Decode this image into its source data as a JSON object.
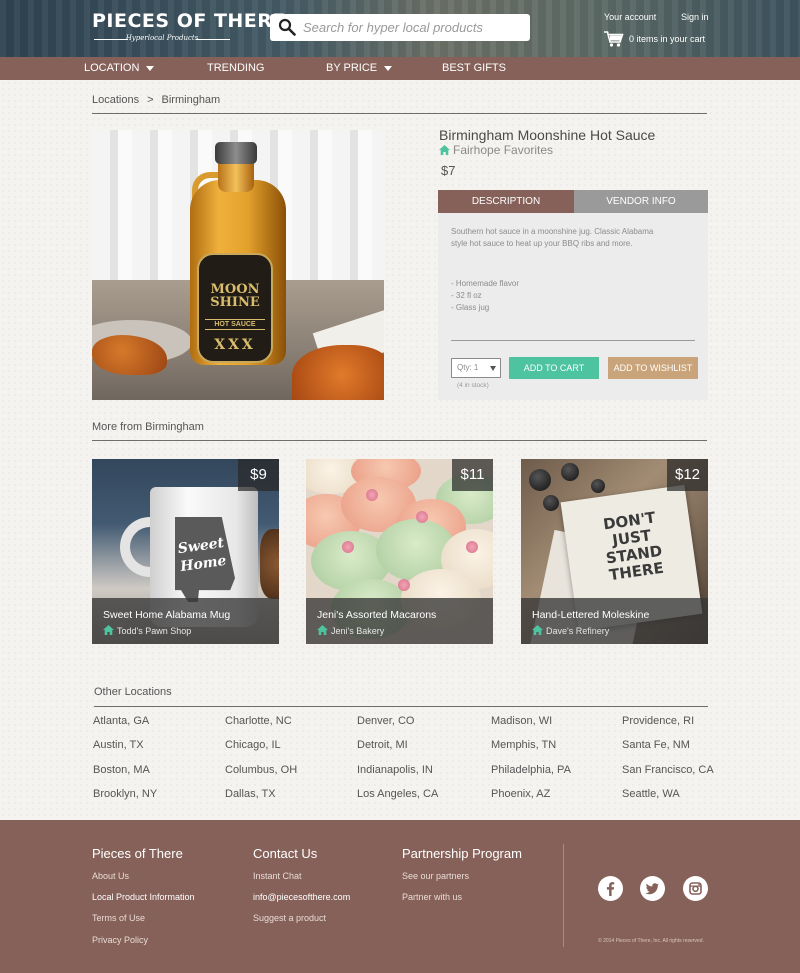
{
  "header": {
    "logo_title": "PIECES OF THERE",
    "logo_subtitle": "Hyperlocal Products",
    "search_placeholder": "Search for hyper local products",
    "account_link": "Your account",
    "signin_link": "Sign in",
    "cart_text": "0 items in your cart"
  },
  "nav": {
    "items": [
      {
        "label": "LOCATION",
        "icon": "caret-down"
      },
      {
        "label": "TRENDING"
      },
      {
        "label": "BY PRICE",
        "icon": "caret-down"
      },
      {
        "label": "BEST GIFTS"
      }
    ]
  },
  "breadcrumb": {
    "items": [
      "Locations",
      "Birmingham"
    ],
    "separator": ">"
  },
  "product": {
    "label_line1": "MOON",
    "label_line2": "SHINE",
    "label_line3": "HOT SAUCE",
    "label_line4": "XXX",
    "name": "Birmingham Moonshine Hot Sauce",
    "vendor": "Fairhope Favorites",
    "price": "$7",
    "tabs": [
      "DESCRIPTION",
      "VENDOR INFO"
    ],
    "description": "Southern hot sauce in a moonshine jug. Classic Alabama style hot sauce to heat up your BBQ ribs and more.",
    "bullets": [
      "- Homemade flavor",
      "- 32 fl oz",
      "- Glass jug"
    ],
    "qty_label": "Qty: 1",
    "stock": "(4 in stock)",
    "add_to_cart": "ADD TO CART",
    "add_to_wishlist": "ADD TO WISHLIST"
  },
  "more_from": {
    "title": "More from Birmingham",
    "items": [
      {
        "price": "$9",
        "name": "Sweet Home Alabama Mug",
        "vendor": "Todd's Pawn Shop",
        "image_text_1": "Sweet",
        "image_text_2": "Home"
      },
      {
        "price": "$11",
        "name": "Jeni's Assorted Macarons",
        "vendor": "Jeni's Bakery"
      },
      {
        "price": "$12",
        "name": "Hand-Lettered Moleskine",
        "vendor": "Dave's Refinery",
        "image_text": "DON'T JUST STAND THERE"
      }
    ]
  },
  "other_locations": {
    "title": "Other Locations",
    "columns": [
      [
        "Atlanta, GA",
        "Austin, TX",
        "Boston, MA",
        "Brooklyn, NY"
      ],
      [
        "Charlotte, NC",
        "Chicago, IL",
        "Columbus, OH",
        "Dallas, TX"
      ],
      [
        "Denver, CO",
        "Detroit, MI",
        "Indianapolis, IN",
        "Los Angeles, CA"
      ],
      [
        "Madison, WI",
        "Memphis, TN",
        "Philadelphia, PA",
        "Phoenix, AZ"
      ],
      [
        "Providence, RI",
        "Santa Fe, NM",
        "San Francisco, CA",
        "Seattle, WA"
      ]
    ]
  },
  "footer": {
    "col1": {
      "heading": "Pieces of There",
      "links": [
        "About Us",
        "Local Product Information",
        "Terms of Use",
        "Privacy Policy"
      ]
    },
    "col2": {
      "heading": "Contact Us",
      "links": [
        "Instant Chat",
        "info@piecesofthere.com",
        "Suggest a product"
      ]
    },
    "col3": {
      "heading": "Partnership Program",
      "links": [
        "See our partners",
        "Partner with us"
      ]
    },
    "social": [
      "facebook-icon",
      "twitter-icon",
      "instagram-icon"
    ],
    "copyright": "© 2014 Pieces of There, Inc. All rights reserved."
  },
  "colors": {
    "brand_brown": "#866159",
    "accent_green": "#4ec3a0",
    "wishlist_tan": "#c9a47b"
  }
}
